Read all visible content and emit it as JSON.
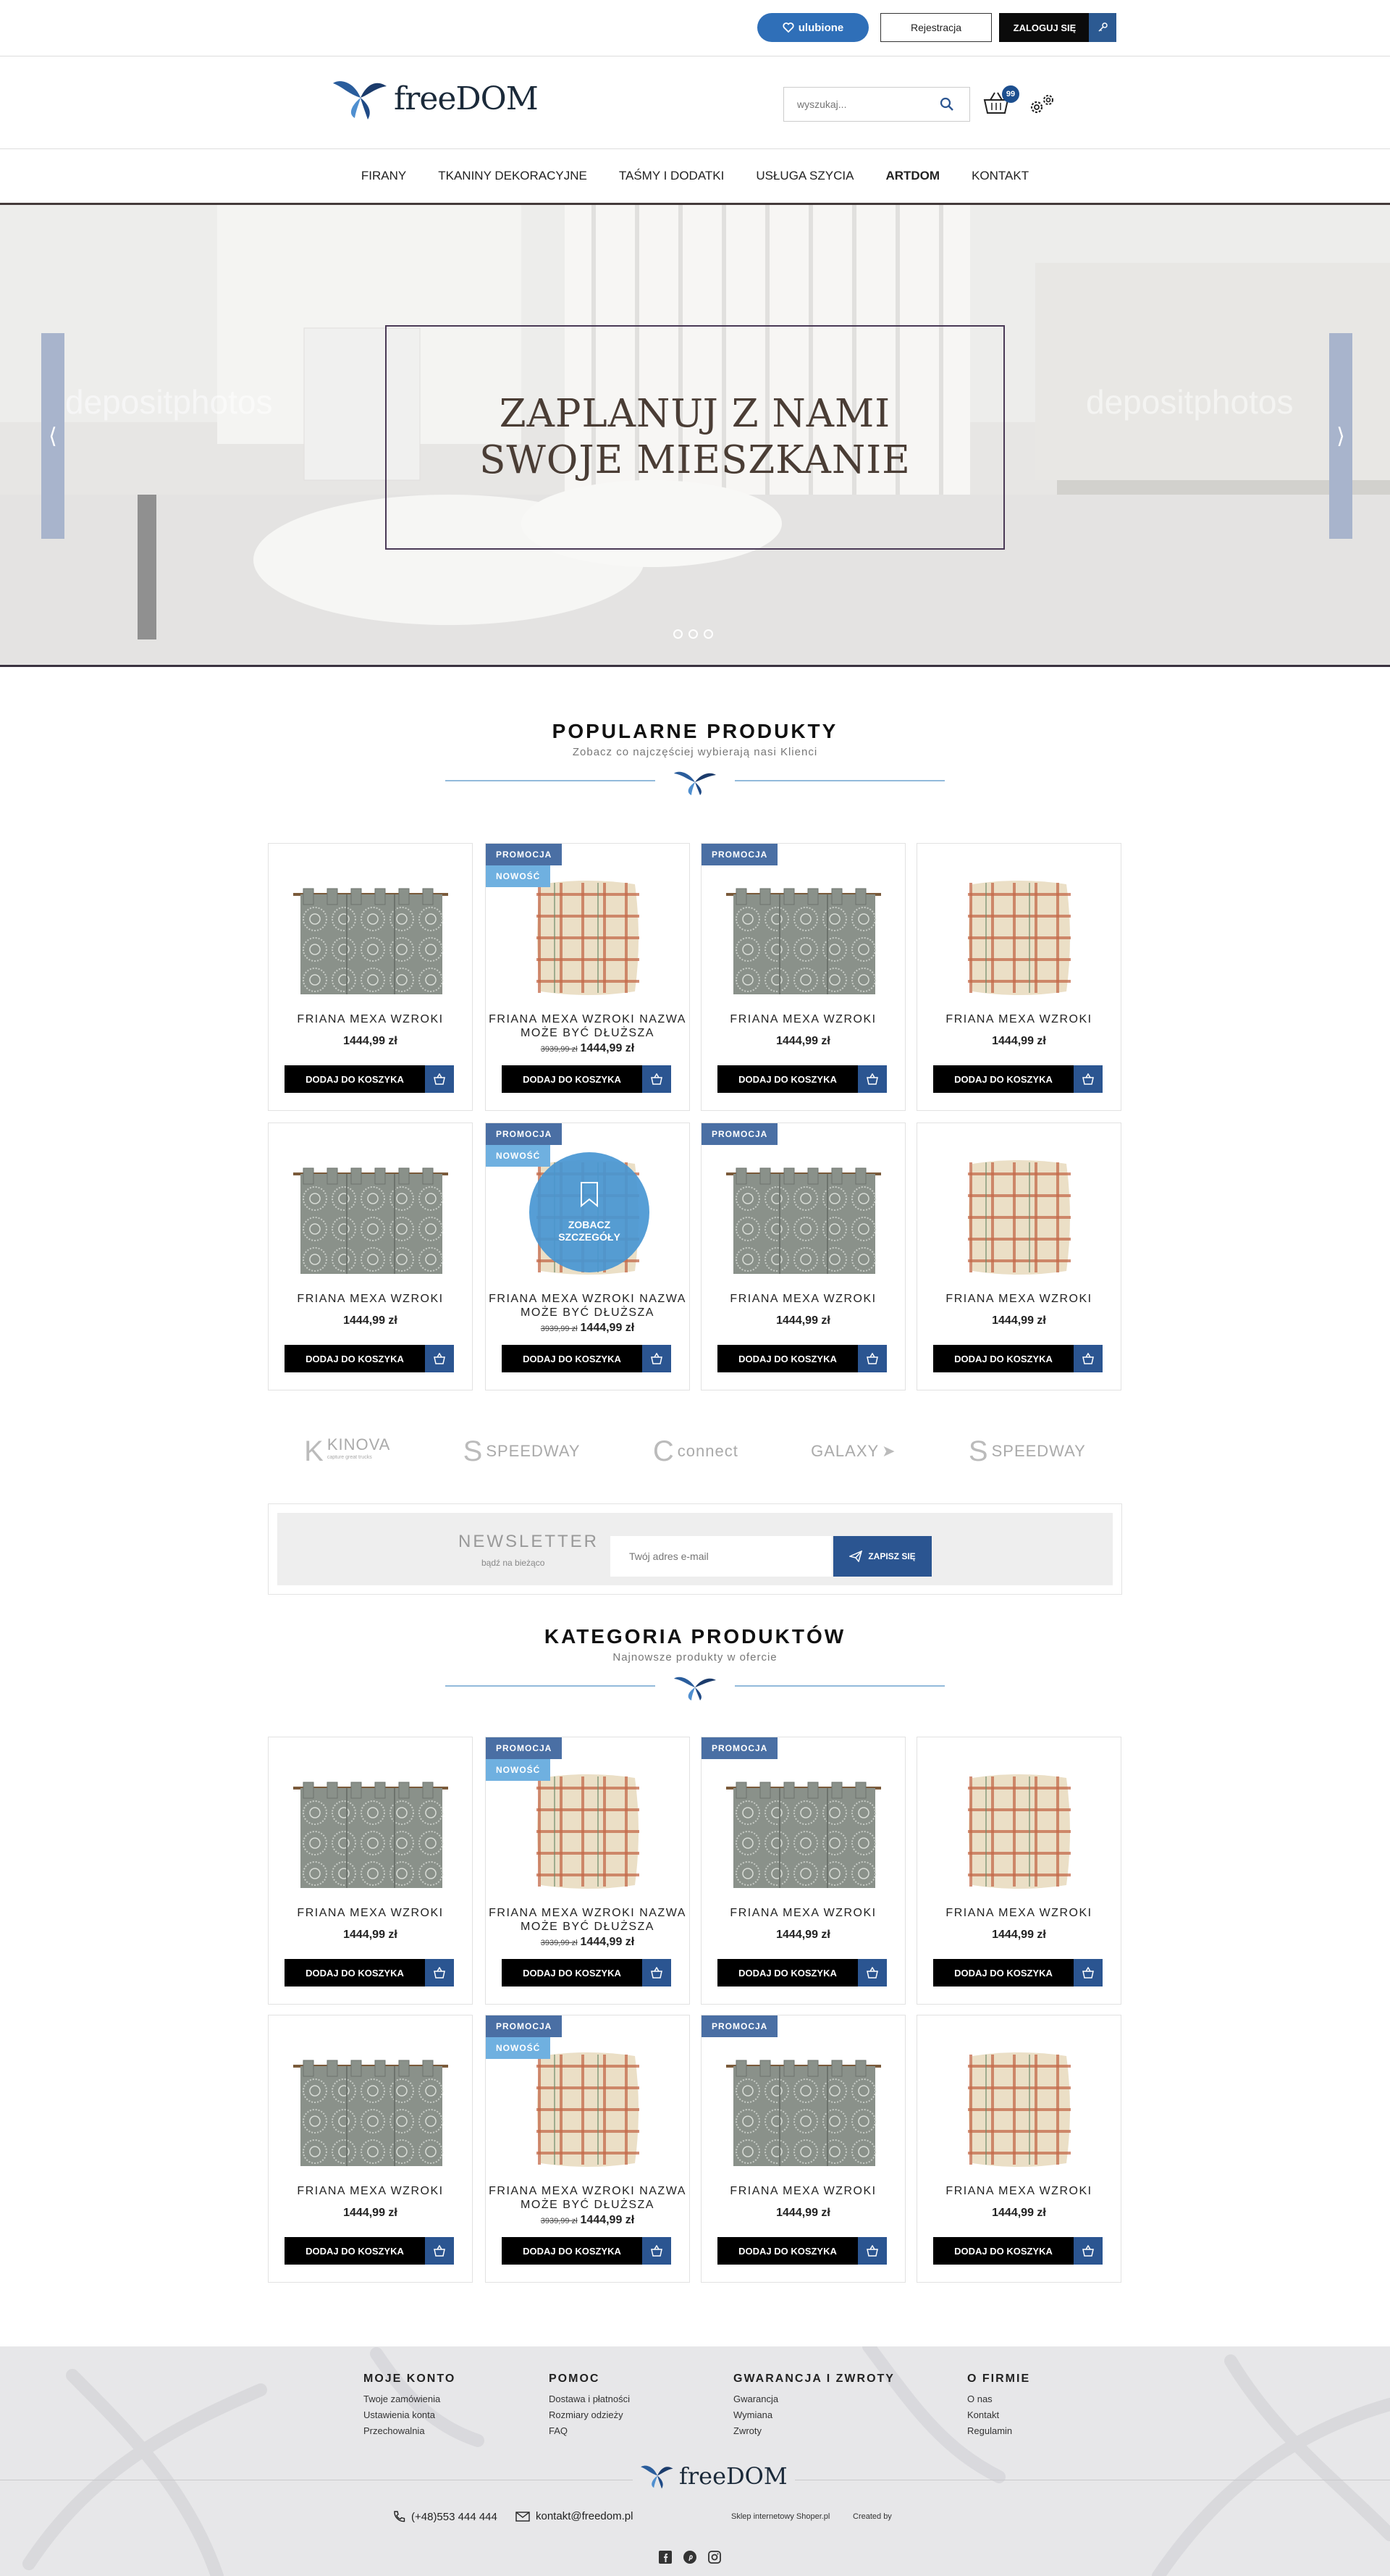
{
  "topbar": {
    "favorites": "ulubione",
    "register": "Rejestracja",
    "login": "ZALOGUJ SIĘ"
  },
  "header": {
    "logo": "freeDOM",
    "search_placeholder": "wyszukaj...",
    "cart_count": "99"
  },
  "nav": [
    "FIRANY",
    "TKANINY DEKORACYJNE",
    "TAŚMY I DODATKI",
    "USŁUGA SZYCIA",
    "ARTDOM",
    "KONTAKT"
  ],
  "hero": {
    "line1": "ZAPLANUJ Z NAMI",
    "line2": "SWOJE MIESZKANIE",
    "prev": "⟨",
    "next": "⟩",
    "watermark": "depositphotos"
  },
  "popular": {
    "title": "POPULARNE PRODUKTY",
    "subtitle": "Zobacz co najczęściej wybierają nasi Klienci"
  },
  "category": {
    "title": "KATEGORIA PRODUKTÓW",
    "subtitle": "Najnowsze produkty w ofercie"
  },
  "labels": {
    "promo": "PROMOCJA",
    "new": "NOWOŚĆ",
    "add": "DODAJ DO KOSZYKA",
    "details": "ZOBACZ SZCZEGÓŁY"
  },
  "products": [
    {
      "name": "FRIANA MEXA WZROKI",
      "price": "1444,99 zł",
      "img": "curtain",
      "promo": false,
      "new": false
    },
    {
      "name": "FRIANA MEXA WZROKI NAZWA MOŻE BYĆ DŁUŻSZA",
      "price": "1444,99 zł",
      "old": "3939,99 zł",
      "img": "pillow",
      "promo": true,
      "new": true
    },
    {
      "name": "FRIANA MEXA WZROKI",
      "price": "1444,99 zł",
      "img": "curtain",
      "promo": true,
      "new": false
    },
    {
      "name": "FRIANA MEXA WZROKI",
      "price": "1444,99 zł",
      "img": "pillow",
      "promo": false,
      "new": false
    }
  ],
  "brands": [
    "KINOVA",
    "SPEEDWAY",
    "connect",
    "GALAXY",
    "SPEEDWAY"
  ],
  "brand_tagline": "capture great trucks",
  "newsletter": {
    "title": "NEWSLETTER",
    "subtitle": "bądź na bieżąco",
    "placeholder": "Twój adres e-mail",
    "button": "ZAPISZ SIĘ"
  },
  "footer": {
    "cols": [
      {
        "title": "MOJE KONTO",
        "links": [
          "Twoje zamówienia",
          "Ustawienia konta",
          "Przechowalnia"
        ]
      },
      {
        "title": "POMOC",
        "links": [
          "Dostawa i płatności",
          "Rozmiary odzieży",
          "FAQ"
        ]
      },
      {
        "title": "GWARANCJA I ZWROTY",
        "links": [
          "Gwarancja",
          "Wymiana",
          "Zwroty"
        ]
      },
      {
        "title": "O FIRMIE",
        "links": [
          "O nas",
          "Kontakt",
          "Regulamin"
        ]
      }
    ],
    "logo": "freeDOM",
    "phone": "(+48)553 444 444",
    "email": "kontakt@freedom.pl",
    "shoper": "Sklep internetowy Shoper.pl",
    "created": "Created by"
  },
  "colors": {
    "accent": "#2b5591",
    "fav": "#2f6fb8",
    "promo": "#4a6fa4",
    "new": "#6fb0e0"
  }
}
